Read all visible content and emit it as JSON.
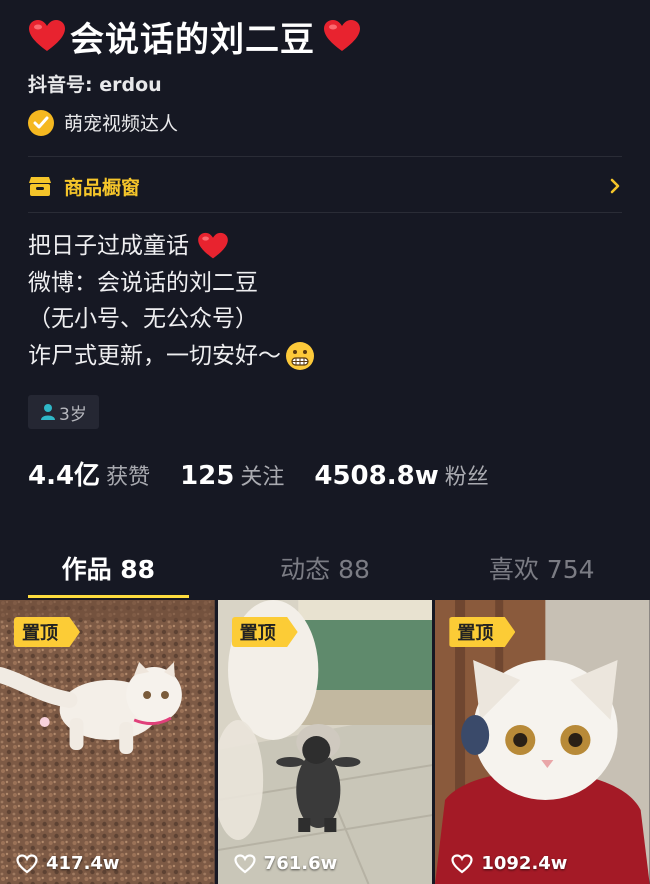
{
  "profile": {
    "name": "会说话的刘二豆",
    "account_label": "抖音号: ",
    "account_id": "erdou",
    "badge": "萌宠视频达人"
  },
  "shop": {
    "label": "商品橱窗"
  },
  "bio": {
    "line1": "把日子过成童话",
    "line2": "微博：会说话的刘二豆",
    "line3": "（无小号、无公众号）",
    "line4": "诈尸式更新，一切安好～"
  },
  "age": "3岁",
  "stats": {
    "likes": {
      "value": "4.4亿",
      "label": "获赞"
    },
    "following": {
      "value": "125",
      "label": "关注"
    },
    "followers": {
      "value": "4508.8w",
      "label": "粉丝"
    }
  },
  "tabs": [
    {
      "label": "作品 88",
      "active": true
    },
    {
      "label": "动态 88",
      "active": false
    },
    {
      "label": "喜欢 754",
      "active": false
    }
  ],
  "videos": [
    {
      "pin_label": "置顶",
      "plays": "417.4w"
    },
    {
      "pin_label": "置顶",
      "plays": "761.6w"
    },
    {
      "pin_label": "置顶",
      "plays": "1092.4w"
    }
  ],
  "colors": {
    "background": "#161823",
    "accent_yellow": "#fedc3e",
    "shop_yellow": "#f5c52a",
    "heart_red": "#e8232f"
  },
  "icons": [
    "heart-icon",
    "verified-check-icon",
    "shop-icon",
    "chevron-right-icon",
    "grimace-emoji-icon",
    "person-icon",
    "heart-outline-icon"
  ]
}
